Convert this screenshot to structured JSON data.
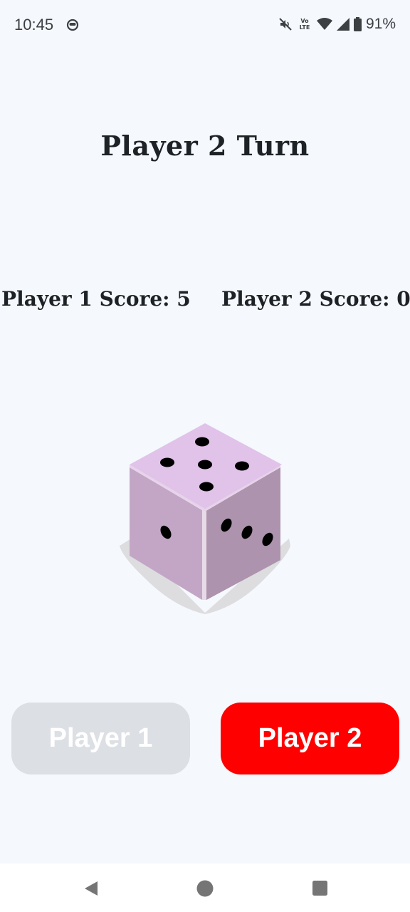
{
  "status_bar": {
    "time": "10:45",
    "network_label": "Vo LTE",
    "battery": "91%",
    "icons": [
      "app-notification-icon",
      "mute-icon",
      "volte-icon",
      "wifi-icon",
      "signal-icon",
      "battery-icon"
    ]
  },
  "game": {
    "turn_title": "Player 2 Turn",
    "player1_score_text": "Player 1 Score: 5",
    "player2_score_text": "Player 2 Score: 0",
    "dice": {
      "top_face": 5,
      "left_face": 1,
      "right_face": 3
    }
  },
  "buttons": {
    "player1": {
      "label": "Player 1",
      "enabled": false,
      "color": "#dcdfe4"
    },
    "player2": {
      "label": "Player 2",
      "enabled": true,
      "color": "#ff0000"
    }
  },
  "nav_bar": {
    "icons": [
      "back-icon",
      "home-icon",
      "recents-icon"
    ]
  },
  "colors": {
    "background": "#f5f8fd",
    "dice_top": "#e1c2e9",
    "dice_left": "#c3a6c6",
    "dice_right": "#ad93ad",
    "pip": "#000000"
  }
}
